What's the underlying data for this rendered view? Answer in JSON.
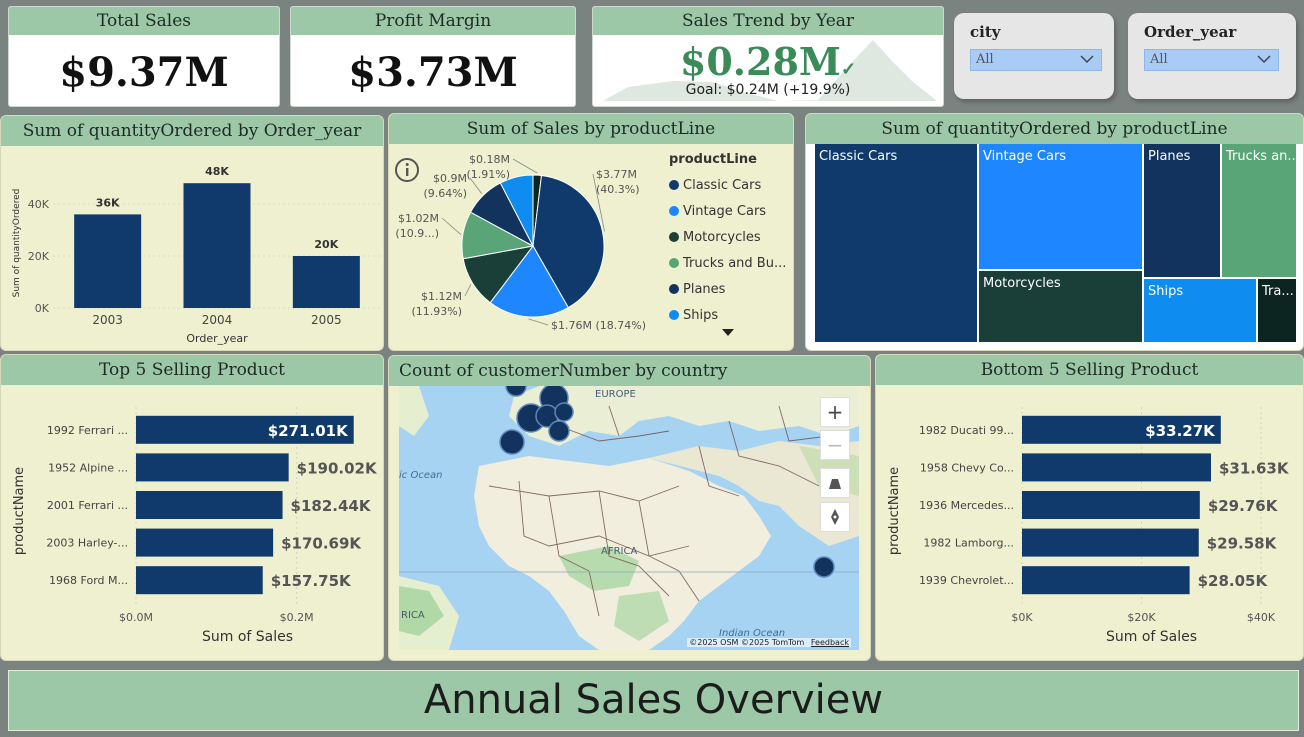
{
  "kpis": {
    "total_sales": {
      "title": "Total Sales",
      "value": "$9.37M"
    },
    "profit_margin": {
      "title": "Profit Margin",
      "value": "$3.73M"
    },
    "sales_trend": {
      "title": "Sales Trend by Year",
      "value": "$0.28M",
      "goal": "Goal: $0.24M (+19.9%)",
      "check": "✓"
    }
  },
  "slicers": {
    "city": {
      "label": "city",
      "value": "All"
    },
    "order_year": {
      "label": "Order_year",
      "value": "All"
    }
  },
  "colors": {
    "dark_blue": "#0f3a6b",
    "light_blue": "#1e86ff",
    "green_dark": "#1a3f38",
    "green": "#5aa578",
    "mid_blue": "#0e6fd6",
    "black_green": "#0d2520",
    "header_green": "#9cc8a8",
    "panel_bg": "#eef0cf"
  },
  "qty_by_year": {
    "title": "Sum of quantityOrdered by Order_year",
    "chart_data": {
      "type": "bar",
      "categories": [
        "2003",
        "2004",
        "2005"
      ],
      "values": [
        36,
        48,
        20
      ],
      "data_labels": [
        "36K",
        "48K",
        "20K"
      ],
      "ylabel": "Sum of quantityOrdered",
      "xlabel": "Order_year",
      "yticks": [
        "0K",
        "20K",
        "40K"
      ],
      "ylim": [
        0,
        50
      ]
    }
  },
  "sales_by_productline": {
    "title": "Sum of Sales by productLine",
    "info_icon": "info-icon",
    "legend_title": "productLine",
    "legend": [
      "Classic Cars",
      "Vintage Cars",
      "Motorcycles",
      "Trucks and Bu...",
      "Planes",
      "Ships"
    ],
    "chart_data": {
      "type": "pie",
      "slices": [
        {
          "name": "Classic Cars",
          "value": 3.77,
          "label": "$3.77M",
          "pct": "(40.3%)",
          "color": "#0f3a6b"
        },
        {
          "name": "Vintage Cars",
          "value": 1.76,
          "label": "$1.76M (18.74%)",
          "pct": "",
          "color": "#1e86ff"
        },
        {
          "name": "Motorcycles",
          "value": 1.12,
          "label": "$1.12M",
          "pct": "(11.93%)",
          "color": "#1a3f38"
        },
        {
          "name": "Trucks and Buses",
          "value": 1.02,
          "label": "$1.02M",
          "pct": "(10.9...)",
          "color": "#5aa578"
        },
        {
          "name": "Planes",
          "value": 0.9,
          "label": "$0.9M",
          "pct": "(9.64%)",
          "color": "#12335e"
        },
        {
          "name": "Ships",
          "value": 0.72,
          "label": "",
          "pct": "",
          "color": "#0e8cf0"
        },
        {
          "name": "Trains",
          "value": 0.18,
          "label": "$0.18M",
          "pct": "(1.91%)",
          "color": "#0d2520"
        }
      ]
    }
  },
  "qty_by_productline": {
    "title": "Sum of quantityOrdered by productLine",
    "chart_data": {
      "type": "treemap",
      "items": [
        {
          "name": "Classic Cars",
          "label": "Classic Cars",
          "color": "#0f3a6b"
        },
        {
          "name": "Vintage Cars",
          "label": "Vintage Cars",
          "color": "#1e86ff"
        },
        {
          "name": "Motorcycles",
          "label": "Motorcycles",
          "color": "#1a3f38"
        },
        {
          "name": "Planes",
          "label": "Planes",
          "color": "#12335e"
        },
        {
          "name": "Trucks and Buses",
          "label": "Trucks an...",
          "color": "#5aa578"
        },
        {
          "name": "Ships",
          "label": "Ships",
          "color": "#0e8cf0"
        },
        {
          "name": "Trains",
          "label": "Tra...",
          "color": "#0d2520"
        }
      ]
    }
  },
  "top5": {
    "title": "Top 5 Selling Product",
    "chart_data": {
      "type": "bar",
      "orientation": "horizontal",
      "categories": [
        "1992 Ferrari ...",
        "1952 Alpine ...",
        "2001 Ferrari ...",
        "2003 Harley-...",
        "1968 Ford M..."
      ],
      "values": [
        271.01,
        190.02,
        182.44,
        170.69,
        157.75
      ],
      "data_labels": [
        "$271.01K",
        "$190.02K",
        "$182.44K",
        "$170.69K",
        "$157.75K"
      ],
      "xlabel": "Sum of Sales",
      "ylabel": "productName",
      "xticks": [
        "$0.0M",
        "$0.2M"
      ],
      "xlim": [
        0,
        300
      ]
    }
  },
  "map": {
    "title": "Count of customerNumber by country",
    "labels": [
      "EUROPE",
      "ic Ocean",
      "AFRICA",
      "RICA",
      "Indian Ocean"
    ],
    "attribution": "©2025 OSM  ©2025 TomTom",
    "feedback": "Feedback",
    "zoom_in": "+",
    "zoom_out": "−"
  },
  "bottom5": {
    "title": "Bottom 5 Selling Product",
    "chart_data": {
      "type": "bar",
      "orientation": "horizontal",
      "categories": [
        "1982 Ducati 99...",
        "1958 Chevy Co...",
        "1936 Mercedes...",
        "1982 Lamborg...",
        "1939 Chevrolet..."
      ],
      "values": [
        33.27,
        31.63,
        29.76,
        29.58,
        28.05
      ],
      "data_labels": [
        "$33.27K",
        "$31.63K",
        "$29.76K",
        "$29.58K",
        "$28.05K"
      ],
      "xlabel": "Sum of Sales",
      "ylabel": "productName",
      "xticks": [
        "$0K",
        "$20K",
        "$40K"
      ],
      "xlim": [
        0,
        40
      ]
    }
  },
  "footer_title": "Annual Sales Overview"
}
